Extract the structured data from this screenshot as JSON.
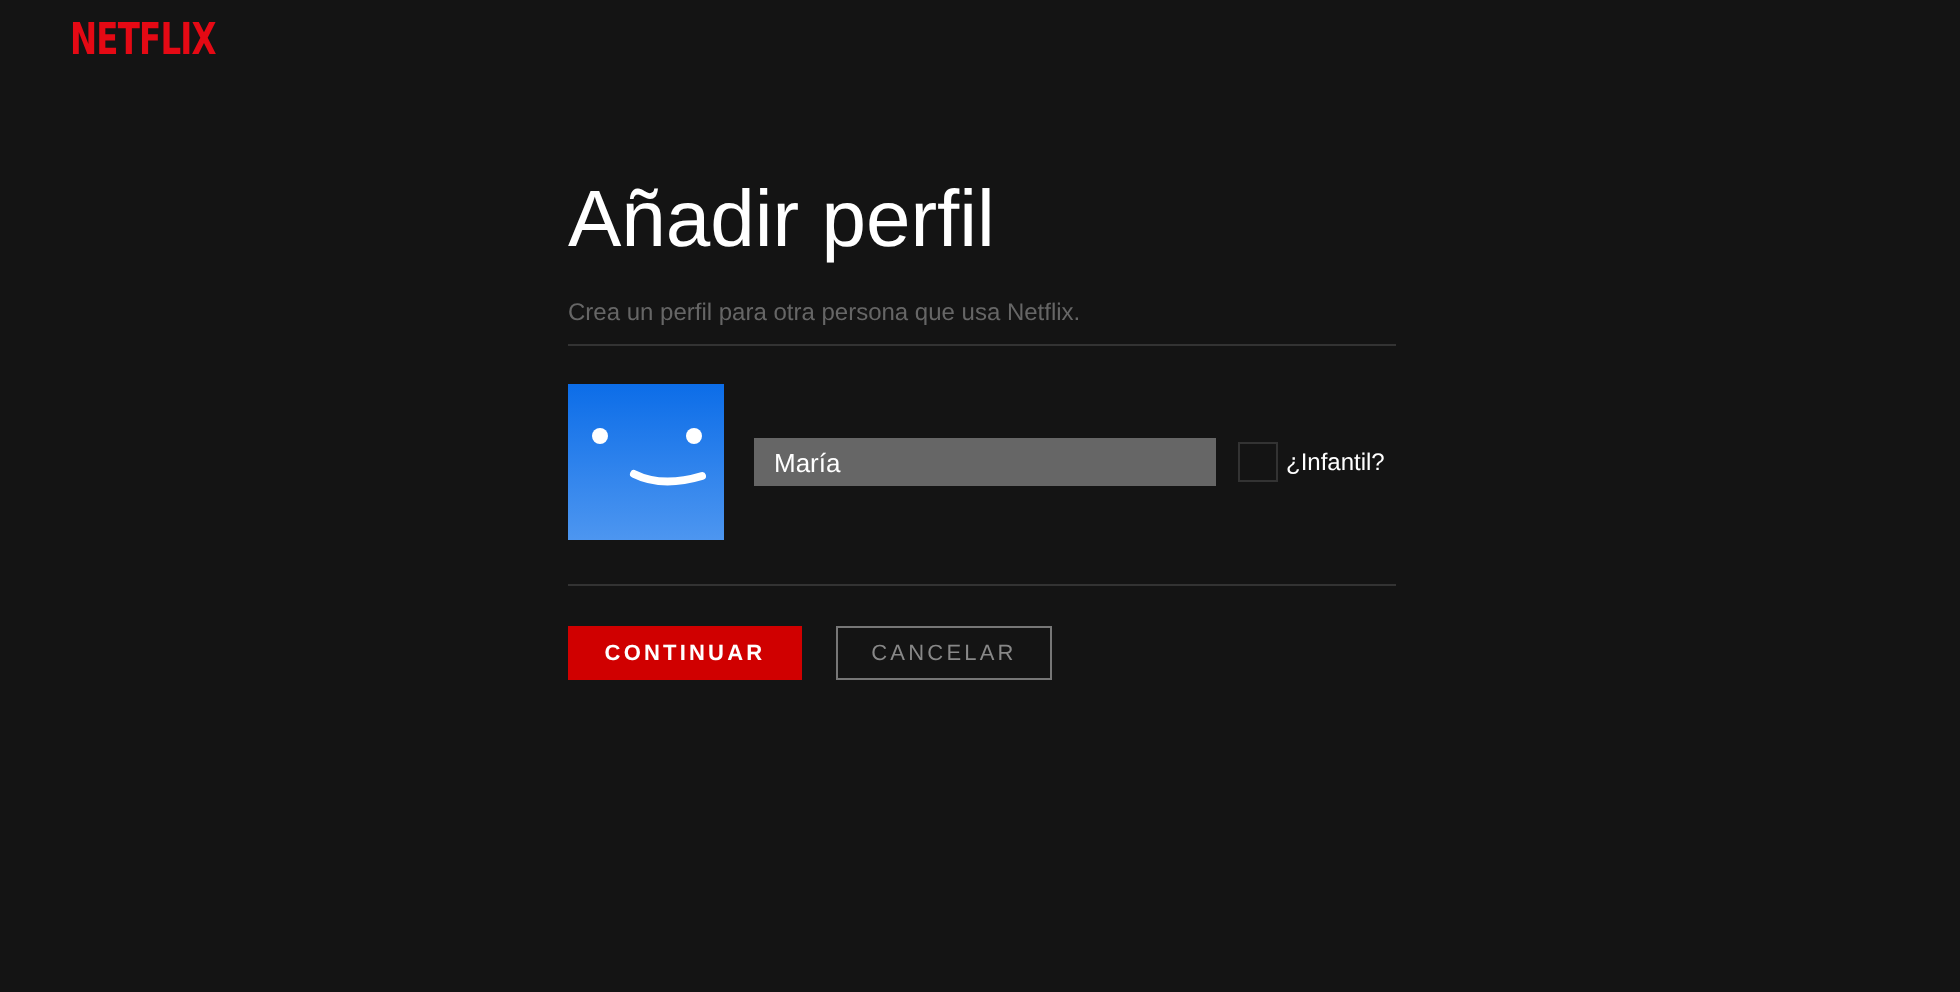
{
  "logo": "NETFLIX",
  "title": "Añadir perfil",
  "subtitle": "Crea un perfil para otra persona que usa Netflix.",
  "name_field": {
    "value": "María"
  },
  "kids_checkbox": {
    "label": "¿Infantil?",
    "checked": false
  },
  "buttons": [
    {
      "label": "CONTINUAR",
      "kind": "primary"
    },
    {
      "label": "CANCELAR",
      "kind": "secondary"
    }
  ]
}
